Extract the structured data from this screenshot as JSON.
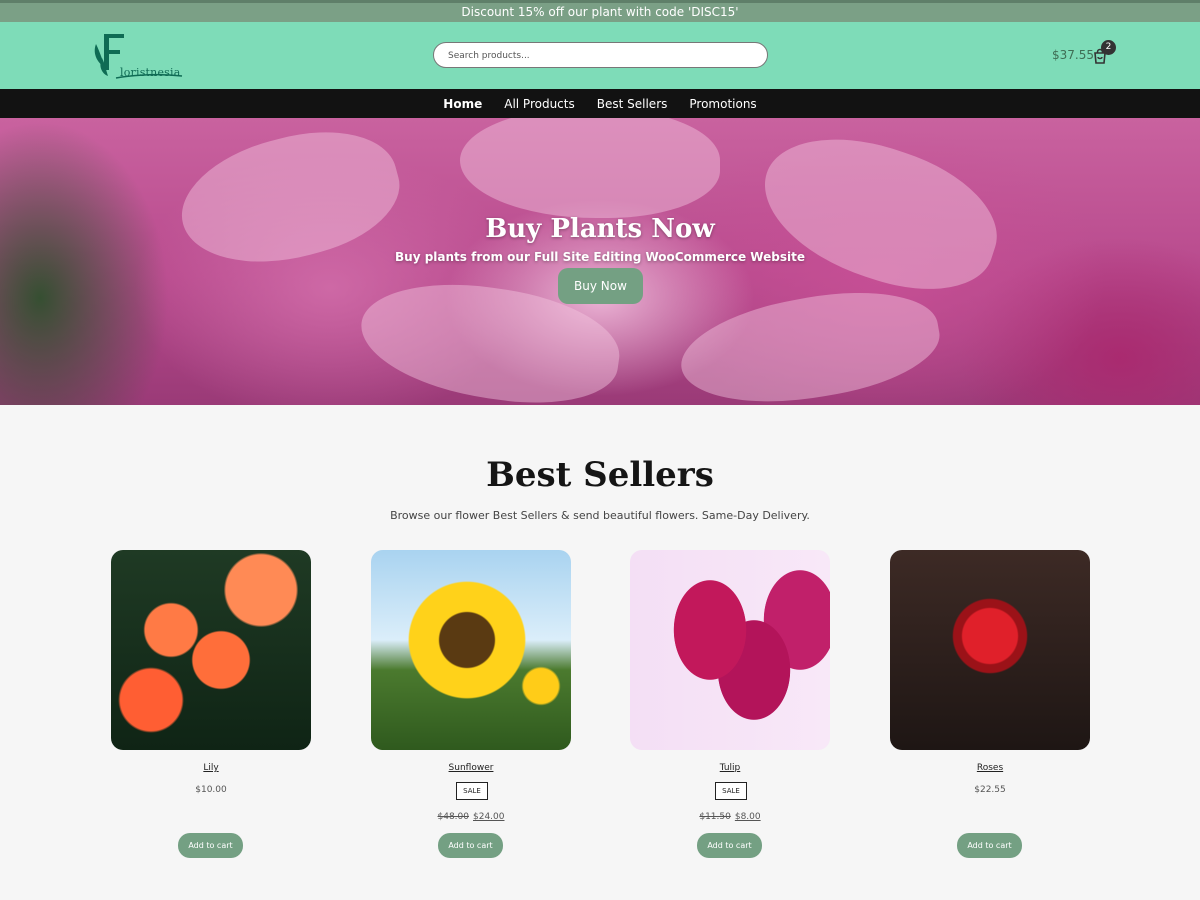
{
  "promo_bar": {
    "text": "Discount 15% off our plant with code 'DISC15'"
  },
  "header": {
    "logo_text": "loristnesia",
    "search": {
      "placeholder": "Search products...",
      "value": ""
    },
    "cart": {
      "total": "$37.55",
      "count": "2"
    }
  },
  "nav": {
    "items": [
      {
        "label": "Home",
        "active": true
      },
      {
        "label": "All Products"
      },
      {
        "label": "Best Sellers"
      },
      {
        "label": "Promotions"
      }
    ]
  },
  "hero": {
    "title": "Buy Plants Now",
    "subtitle": "Buy plants from our Full Site Editing WooCommerce Website",
    "button": "Buy Now"
  },
  "best_sellers": {
    "title": "Best Sellers",
    "subtitle": "Browse our flower Best Sellers & send beautiful flowers. Same-Day Delivery.",
    "products": [
      {
        "name": "Lily",
        "price": "$10.00",
        "add": "Add to cart"
      },
      {
        "name": "Sunflower",
        "sale_badge": "SALE",
        "old_price": "$48.00",
        "price": "$24.00",
        "add": "Add to cart"
      },
      {
        "name": "Tulip",
        "sale_badge": "SALE",
        "old_price": "$11.50",
        "price": "$8.00",
        "add": "Add to cart"
      },
      {
        "name": "Roses",
        "price": "$22.55",
        "add": "Add to cart"
      }
    ]
  },
  "colors": {
    "header_bg": "#7edcb8",
    "promo_bg": "#7ba086",
    "nav_bg": "#121212",
    "button_bg": "#74a083"
  }
}
